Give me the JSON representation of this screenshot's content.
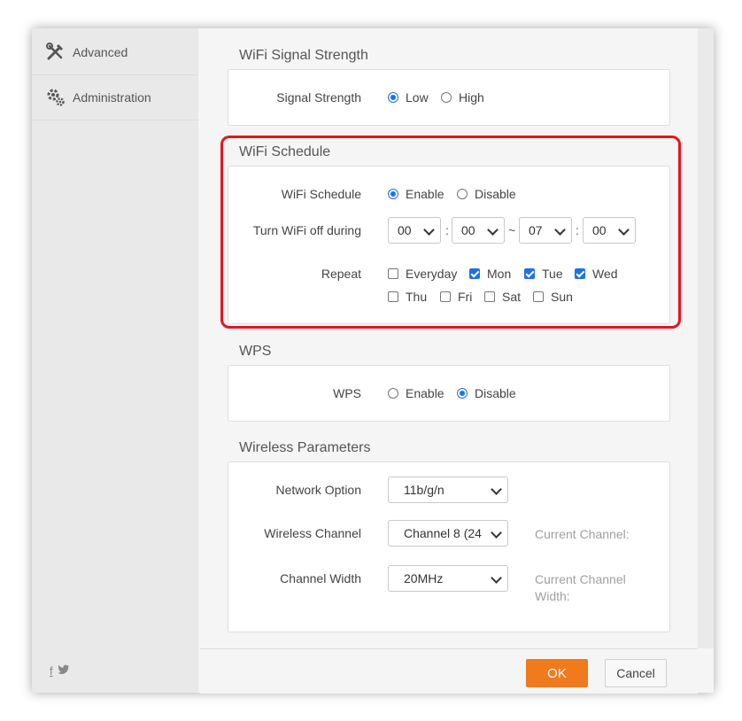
{
  "sidebar": {
    "items": [
      {
        "label": "Advanced",
        "icon": "tools-icon"
      },
      {
        "label": "Administration",
        "icon": "gears-icon"
      }
    ],
    "social": [
      "f",
      "t"
    ]
  },
  "signal_strength": {
    "title": "WiFi Signal Strength",
    "label": "Signal Strength",
    "options": [
      "Low",
      "High"
    ],
    "selected": "Low"
  },
  "schedule": {
    "title": "WiFi Schedule",
    "label": "WiFi Schedule",
    "options": [
      "Enable",
      "Disable"
    ],
    "selected": "Enable",
    "time_label": "Turn WiFi off during",
    "time": {
      "start_hour": "00",
      "start_min": "00",
      "end_hour": "07",
      "end_min": "00"
    },
    "colon": ":",
    "tilde": "~",
    "repeat_label": "Repeat",
    "days": [
      {
        "label": "Everyday",
        "checked": false
      },
      {
        "label": "Mon",
        "checked": true
      },
      {
        "label": "Tue",
        "checked": true
      },
      {
        "label": "Wed",
        "checked": true
      },
      {
        "label": "Thu",
        "checked": false
      },
      {
        "label": "Fri",
        "checked": false
      },
      {
        "label": "Sat",
        "checked": false
      },
      {
        "label": "Sun",
        "checked": false
      }
    ]
  },
  "wps": {
    "title": "WPS",
    "label": "WPS",
    "options": [
      "Enable",
      "Disable"
    ],
    "selected": "Disable"
  },
  "wireless": {
    "title": "Wireless Parameters",
    "network_option_label": "Network Option",
    "network_option_value": "11b/g/n",
    "channel_label": "Wireless Channel",
    "channel_value": "Channel 8 (24",
    "current_channel_label": "Current Channel:",
    "width_label": "Channel Width",
    "width_value": "20MHz",
    "current_width_label": "Current Channel Width:"
  },
  "footer": {
    "ok_label": "OK",
    "cancel_label": "Cancel"
  },
  "colors": {
    "accent": "#1a73e8",
    "ok_button": "#f07a1c",
    "highlight": "#e8141c"
  }
}
